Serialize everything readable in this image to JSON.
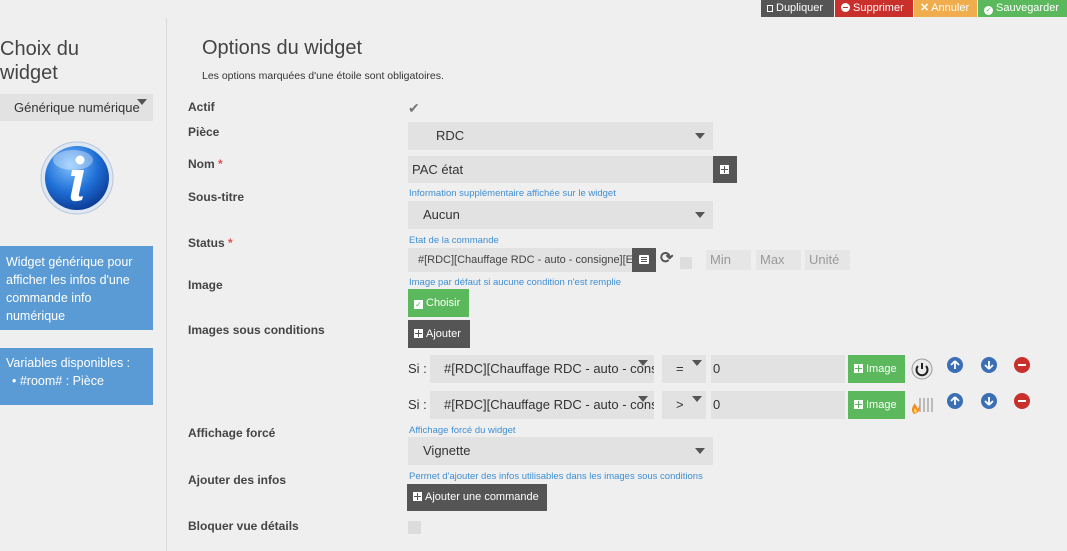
{
  "toolbar": {
    "duplicate": "Dupliquer",
    "delete": "Supprimer",
    "cancel": "Annuler",
    "save": "Sauvegarder"
  },
  "left": {
    "title": "Choix du widget",
    "selected_widget": "Générique numérique",
    "description": "Widget générique pour afficher les infos d'une commande info numérique",
    "variables_title": "Variables disponibles :",
    "variables": [
      "#room# : Pièce"
    ]
  },
  "main": {
    "title": "Options du widget",
    "subtitle": "Les options marquées d'une étoile sont obligatoires.",
    "actif_label": "Actif",
    "piece_label": "Pièce",
    "piece_value": "RDC",
    "nom_label": "Nom",
    "nom_value": "PAC état",
    "soustitre_label": "Sous-titre",
    "soustitre_hint": "Information supplémentaire affichée sur le widget",
    "soustitre_value": "Aucun",
    "status_label": "Status",
    "status_hint": "Etat de la commande",
    "status_value": "#[RDC][Chauffage RDC - auto - consigne][E",
    "min_placeholder": "Min",
    "max_placeholder": "Max",
    "unit_placeholder": "Unité",
    "image_label": "Image",
    "image_hint": "Image par défaut si aucune condition n'est remplie",
    "choose_label": "Choisir",
    "images_cond_label": "Images sous conditions",
    "add_label": "Ajouter",
    "conditions": [
      {
        "si": "Si :",
        "cmd": "#[RDC][Chauffage RDC - auto - cons",
        "op": "=",
        "value": "0",
        "image_btn": "Image"
      },
      {
        "si": "Si :",
        "cmd": "#[RDC][Chauffage RDC - auto - cons",
        "op": ">",
        "value": "0",
        "image_btn": "Image"
      }
    ],
    "affichage_label": "Affichage forcé",
    "affichage_hint": "Affichage forcé du widget",
    "affichage_value": "Vignette",
    "infos_label": "Ajouter des infos",
    "infos_hint": "Permet d'ajouter des infos utilisables dans les images sous conditions",
    "add_cmd_label": "Ajouter une commande",
    "bloquer_label": "Bloquer vue détails",
    "required_mark": "*"
  },
  "colors": {
    "dark": "#555555",
    "red": "#c9302c",
    "orange": "#f0ad4e",
    "green": "#5cb85c",
    "blue_panel": "#5b9bd5",
    "link_blue": "#3f8fd4"
  }
}
